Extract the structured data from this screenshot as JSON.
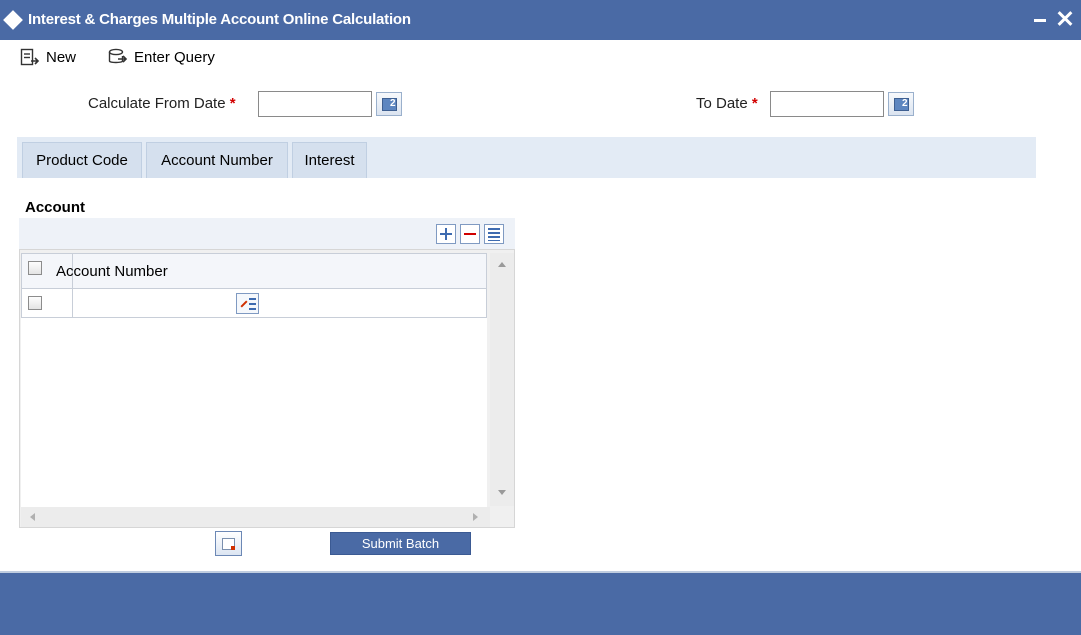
{
  "window": {
    "title": "Interest & Charges Multiple Account Online Calculation"
  },
  "toolbar": {
    "new_label": "New",
    "enter_query_label": "Enter Query"
  },
  "header_form": {
    "from_date_label": "Calculate From Date",
    "from_date_value": "",
    "to_date_label": "To Date",
    "to_date_value": "",
    "required_marker": "*"
  },
  "tabs": [
    {
      "label": "Product Code"
    },
    {
      "label": "Account Number"
    },
    {
      "label": "Interest"
    }
  ],
  "account_section": {
    "title": "Account",
    "column_header": "Account Number",
    "rows": [
      {
        "account_number": ""
      }
    ]
  },
  "actions": {
    "submit_label": "Submit Batch"
  },
  "colors": {
    "header_blue": "#4a6aa5",
    "required_red": "#d20000",
    "tab_band": "#e3ebf5"
  },
  "icons": {
    "title": "diamond-icon",
    "minimize": "minimize-icon",
    "close": "close-icon",
    "new": "new-document-icon",
    "enter_query": "query-icon",
    "calendar": "calendar-icon",
    "add_row": "plus-icon",
    "delete_row": "minus-icon",
    "single_view": "list-view-icon",
    "lov": "lov-icon",
    "audit": "audit-icon"
  }
}
